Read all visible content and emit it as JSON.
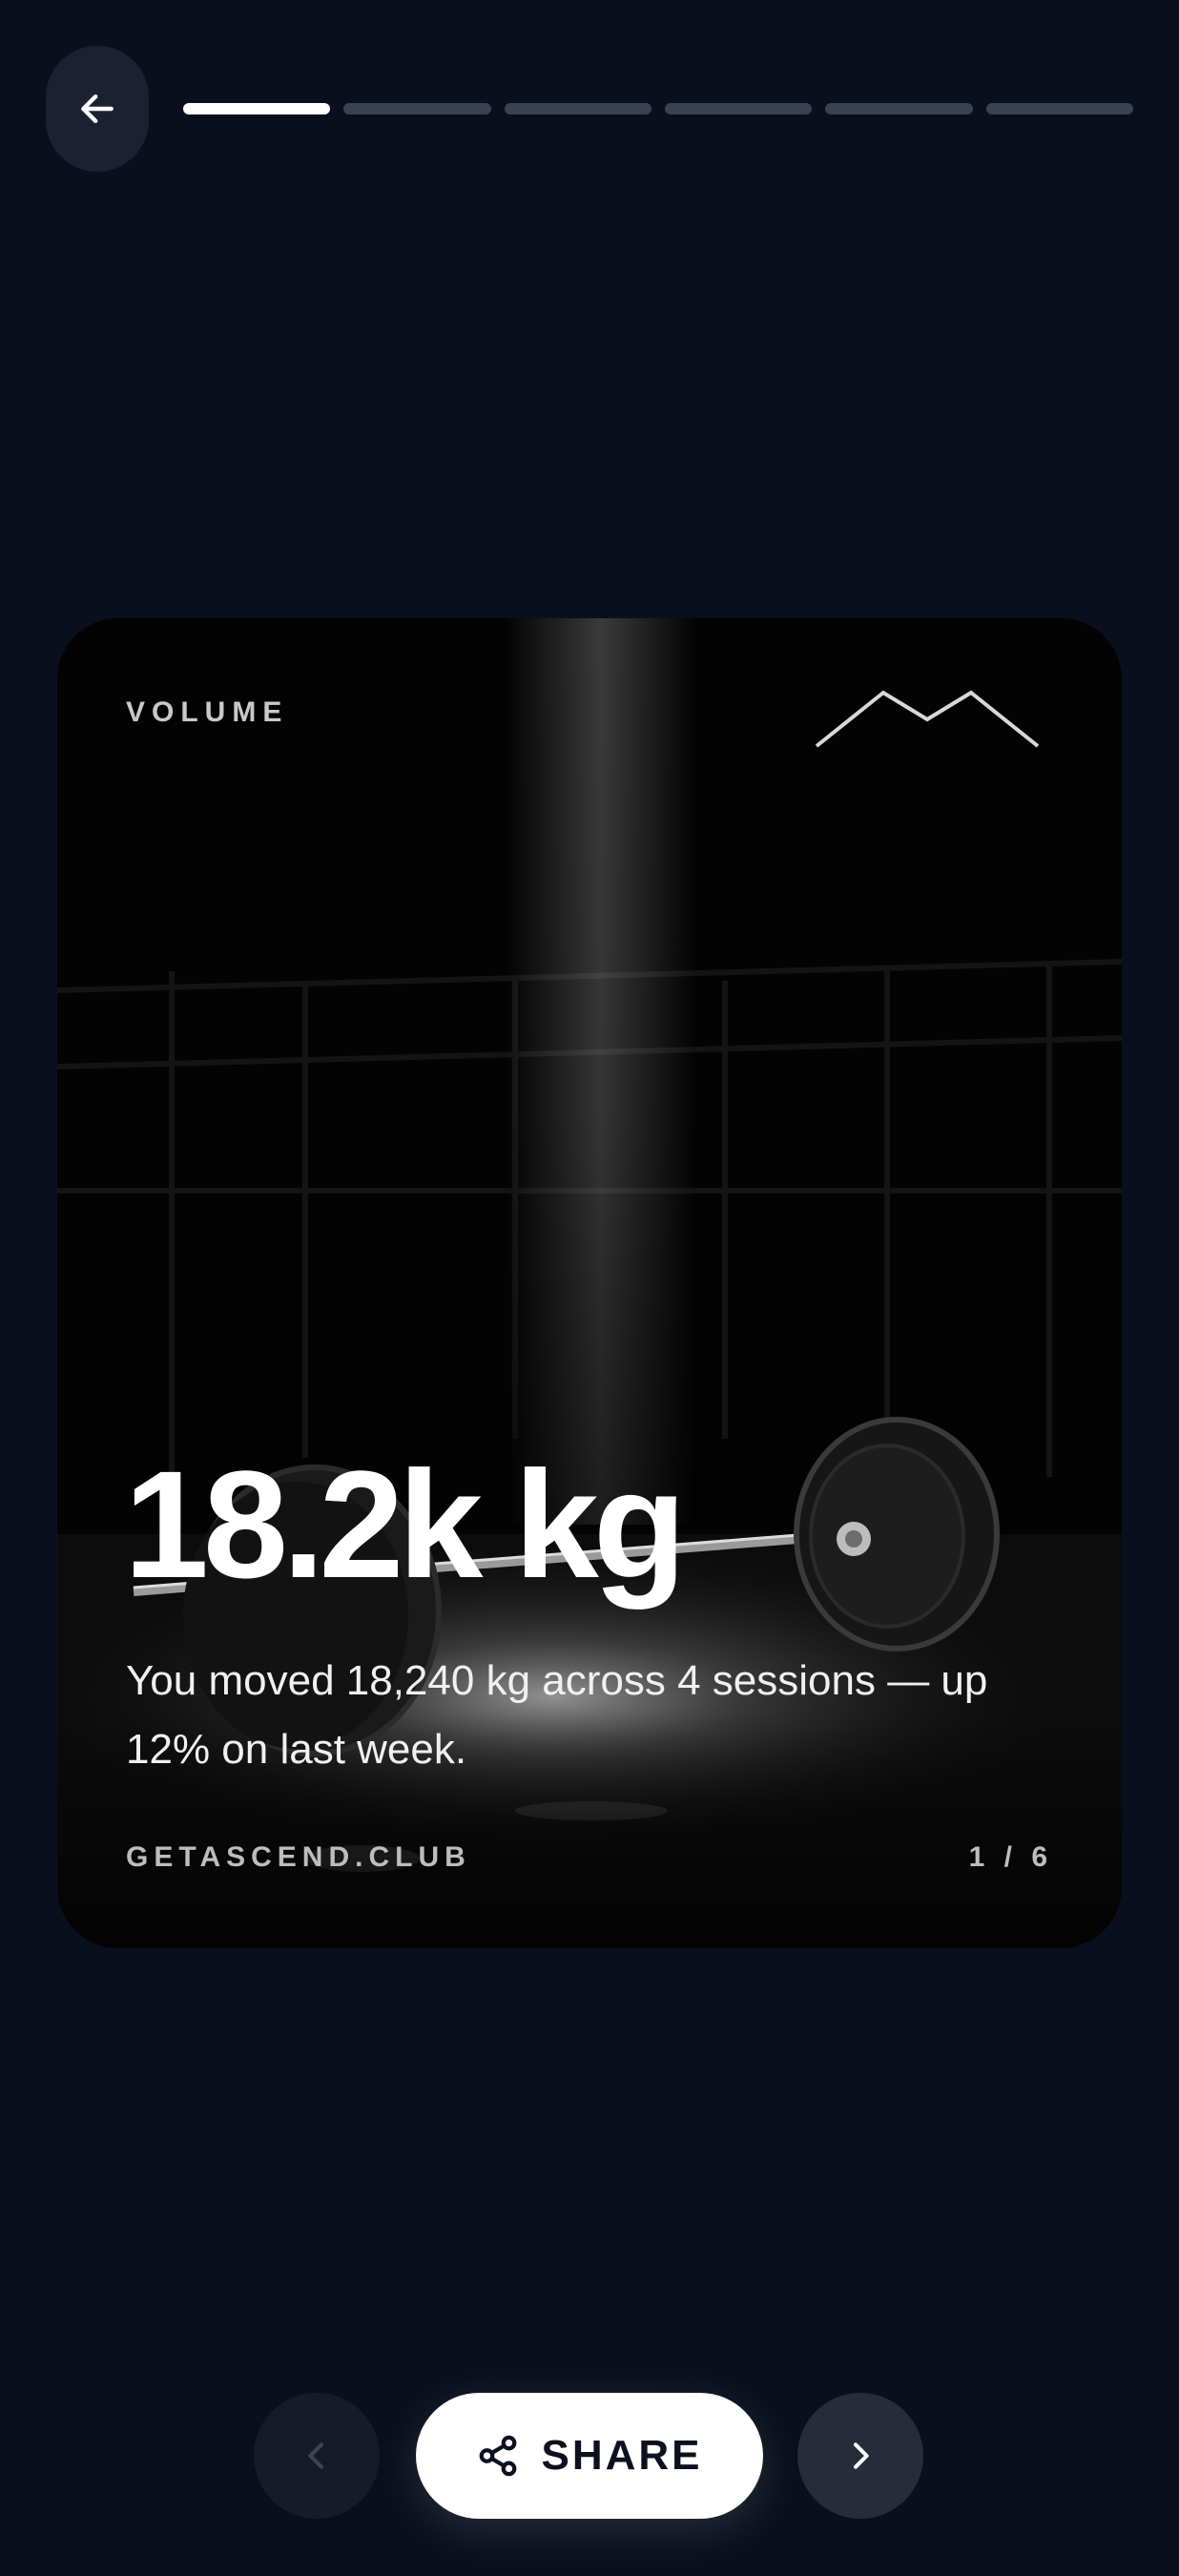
{
  "header": {
    "back_icon": "arrow-left-icon",
    "progress": {
      "total_steps": 6,
      "current_step": 1
    }
  },
  "card": {
    "label": "VOLUME",
    "logo_icon": "mountain-peaks-icon",
    "big_stat": "18.2k kg",
    "description": "You moved 18,240 kg across 4 sessions — up 12% on last week.",
    "domain": "GETASCEND.CLUB",
    "pager": "1 / 6",
    "background_image": "barbell-on-gym-floor-photo"
  },
  "controls": {
    "prev_icon": "chevron-left-icon",
    "share_icon": "share-icon",
    "share_label": "SHARE",
    "next_icon": "chevron-right-icon"
  },
  "colors": {
    "background": "#0a0f1d",
    "accent": "#ffffff",
    "progress_inactive": "#3a4150"
  }
}
